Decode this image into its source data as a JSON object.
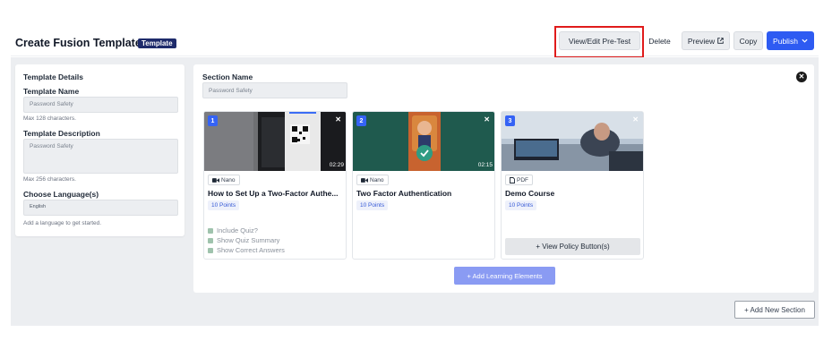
{
  "header": {
    "title": "Create Fusion Template",
    "badge": "Template",
    "buttons": {
      "view_edit_pretest": "View/Edit Pre-Test",
      "delete": "Delete",
      "preview": "Preview",
      "copy": "Copy",
      "publish": "Publish"
    }
  },
  "template_details": {
    "heading": "Template Details",
    "name_label": "Template Name",
    "name_value": "Password Safety",
    "name_help": "Max 128 characters.",
    "description_label": "Template Description",
    "description_value": "Password Safety",
    "description_help": "Max 256 characters.",
    "language_label": "Choose Language(s)",
    "language_value": "English",
    "language_help": "Add a language to get started."
  },
  "section": {
    "name_label": "Section Name",
    "name_value": "Password Safety"
  },
  "cards": [
    {
      "number": "1",
      "duration": "02:29",
      "type": "Nano",
      "title": "How to Set Up a Two-Factor Authe...",
      "points": "10 Points",
      "options": [
        "Include Quiz?",
        "Show Quiz Summary",
        "Show Correct Answers"
      ]
    },
    {
      "number": "2",
      "duration": "02:15",
      "type": "Nano",
      "title": "Two Factor Authentication",
      "points": "10 Points"
    },
    {
      "number": "3",
      "type": "PDF",
      "title": "Demo Course",
      "points": "10 Points",
      "policy_button": "+ View Policy Button(s)"
    }
  ],
  "add_learning_label": "+ Add Learning Elements",
  "add_section_label": "+ Add New Section",
  "colors": {
    "accent": "#2e5bf2",
    "badge": "#1e2b6b",
    "highlight": "#e01b1b"
  }
}
